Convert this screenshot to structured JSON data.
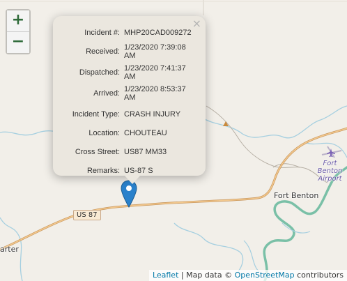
{
  "map": {
    "zoom_in_label": "+",
    "zoom_out_label": "−",
    "places": {
      "fort_benton": "Fort Benton",
      "airport_line1": "Fort Benton",
      "airport_line2": "Airport",
      "partial_town": "arter"
    },
    "route_shield": "US 87",
    "colors": {
      "land": "#f2efe9",
      "river": "#a5cfe0",
      "main_river": "#7ac0a7",
      "highway": "#d9a066",
      "road": "#b5aea3",
      "marker": "#2a81cb",
      "popup_bg": "#ebe7df"
    }
  },
  "popup": {
    "close_label": "×",
    "rows": [
      {
        "key": "Incident #:",
        "value": "MHP20CAD009272"
      },
      {
        "key": "Received:",
        "value": "1/23/2020 7:39:08 AM"
      },
      {
        "key": "Dispatched:",
        "value": "1/23/2020 7:41:37 AM"
      },
      {
        "key": "Arrived:",
        "value": "1/23/2020 8:53:37 AM"
      },
      {
        "key": "Incident Type:",
        "value": "CRASH INJURY"
      },
      {
        "key": "Location:",
        "value": "CHOUTEAU"
      },
      {
        "key": "Cross Street:",
        "value": "US87 MM33"
      },
      {
        "key": "Remarks:",
        "value": "US-87 S"
      }
    ]
  },
  "attribution": {
    "leaflet": "Leaflet",
    "separator": " | Map data © ",
    "osm": "OpenStreetMap",
    "suffix": " contributors"
  },
  "icons": {
    "marker": "map-marker-icon",
    "airport": "airplane-icon",
    "peak": "peak-triangle-icon"
  }
}
